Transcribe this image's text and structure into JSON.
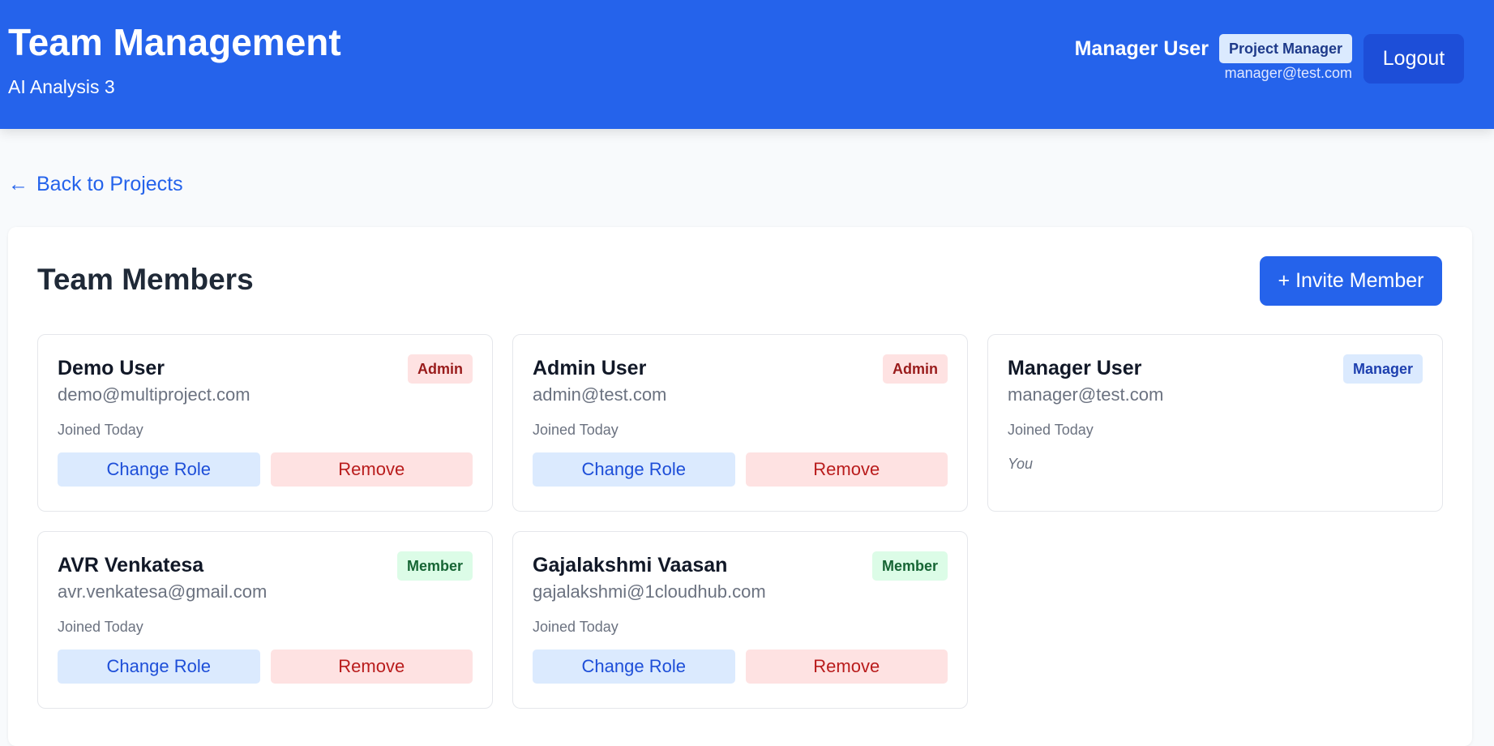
{
  "header": {
    "title": "Team Management",
    "subtitle": "AI Analysis 3",
    "user_name": "Manager User",
    "user_role": "Project Manager",
    "user_email": "manager@test.com",
    "logout_label": "Logout"
  },
  "back_link": {
    "arrow": "←",
    "label": "Back to Projects"
  },
  "panel": {
    "title": "Team Members",
    "invite_label": "+ Invite Member"
  },
  "members": [
    {
      "name": "Demo User",
      "email": "demo@multiproject.com",
      "badge": "Admin",
      "joined": "Joined Today",
      "change_role": "Change Role",
      "remove": "Remove"
    },
    {
      "name": "Admin User",
      "email": "admin@test.com",
      "badge": "Admin",
      "joined": "Joined Today",
      "change_role": "Change Role",
      "remove": "Remove"
    },
    {
      "name": "Manager User",
      "email": "manager@test.com",
      "badge": "Manager",
      "joined": "Joined Today",
      "you_label": "You"
    },
    {
      "name": "AVR Venkatesa",
      "email": "avr.venkatesa@gmail.com",
      "badge": "Member",
      "joined": "Joined Today",
      "change_role": "Change Role",
      "remove": "Remove"
    },
    {
      "name": "Gajalakshmi Vaasan",
      "email": "gajalakshmi@1cloudhub.com",
      "badge": "Member",
      "joined": "Joined Today",
      "change_role": "Change Role",
      "remove": "Remove"
    }
  ],
  "colors": {
    "header_bg": "#2563eb",
    "admin_badge": "#fee2e2",
    "manager_badge": "#dbeafe",
    "member_badge": "#dcfce7"
  }
}
